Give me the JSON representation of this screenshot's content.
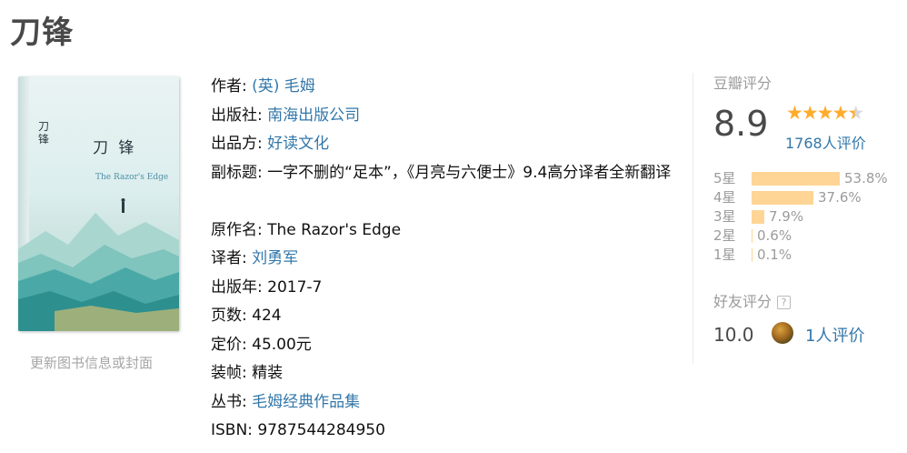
{
  "book": {
    "title": "刀锋",
    "cover": {
      "title": "刀 锋",
      "side_text": "刀锋",
      "english_title": "The Razor's Edge"
    },
    "update_link": "更新图书信息或封面",
    "info": {
      "author_label": "作者:",
      "author": "(英) 毛姆",
      "publisher_label": "出版社:",
      "publisher": "南海出版公司",
      "producer_label": "出品方:",
      "producer": "好读文化",
      "subtitle_label": "副标题:",
      "subtitle": "一字不删的“足本”，《月亮与六便士》9.4高分译者全新翻译",
      "original_title_label": "原作名:",
      "original_title": "The Razor's Edge",
      "translator_label": "译者:",
      "translator": "刘勇军",
      "pub_year_label": "出版年:",
      "pub_year": "2017-7",
      "pages_label": "页数:",
      "pages": "424",
      "price_label": "定价:",
      "price": "45.00元",
      "binding_label": "装帧:",
      "binding": "精装",
      "series_label": "丛书:",
      "series": "毛姆经典作品集",
      "isbn_label": "ISBN:",
      "isbn": "9787544284950"
    }
  },
  "rating": {
    "label": "豆瓣评分",
    "score": "8.9",
    "star_level": 4.5,
    "votes": "1768人评价",
    "distribution": [
      {
        "stars": "5星",
        "percent_text": "53.8%",
        "percent": 53.8
      },
      {
        "stars": "4星",
        "percent_text": "37.6%",
        "percent": 37.6
      },
      {
        "stars": "3星",
        "percent_text": "7.9%",
        "percent": 7.9
      },
      {
        "stars": "2星",
        "percent_text": "0.6%",
        "percent": 0.6
      },
      {
        "stars": "1星",
        "percent_text": "0.1%",
        "percent": 0.1
      }
    ],
    "friend_label": "好友评分",
    "friend_help": "?",
    "friend_score": "10.0",
    "friend_votes": "1人评价"
  },
  "colors": {
    "link": "#3377aa",
    "star": "#ffac2d",
    "bar": "#ffd596"
  }
}
